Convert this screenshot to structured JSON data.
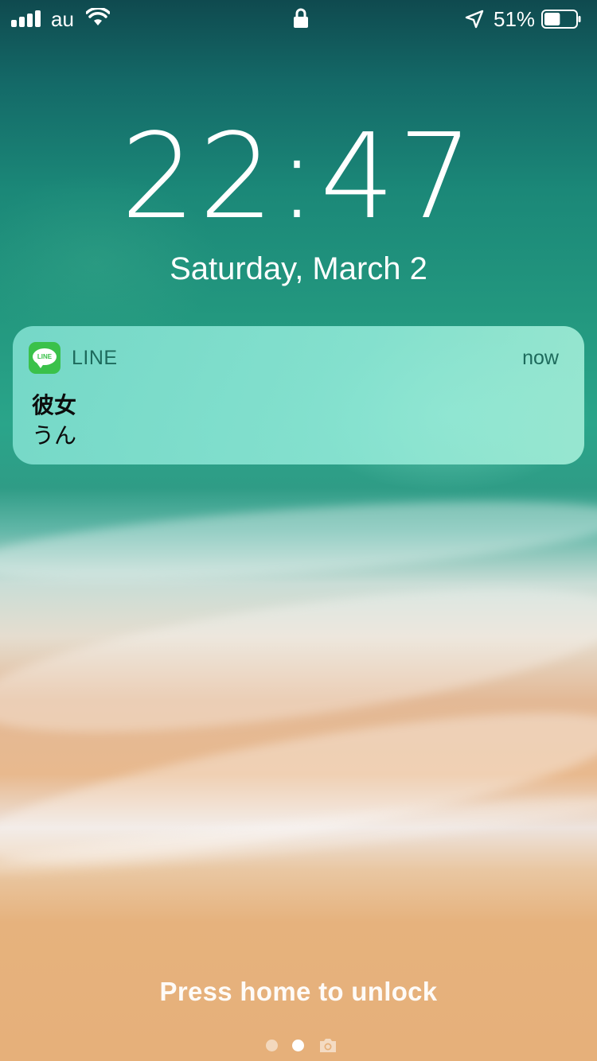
{
  "status_bar": {
    "carrier": "au",
    "battery_percent": "51%",
    "signal_bars": 4,
    "battery_level": 0.51,
    "icons": {
      "signal": "cellular-signal-icon",
      "wifi": "wifi-icon",
      "lock": "lock-icon",
      "location": "location-arrow-icon",
      "battery": "battery-icon"
    }
  },
  "lock_screen": {
    "time": "22:47",
    "date": "Saturday, March 2"
  },
  "notification": {
    "app_name": "LINE",
    "app_icon_text": "LINE",
    "app_icon": "line-app-icon",
    "app_color": "#3ac14a",
    "time": "now",
    "title": "彼女",
    "body": "うん"
  },
  "bottom": {
    "unlock_hint": "Press home to unlock",
    "pages": 2,
    "current_page": 2,
    "camera_icon": "camera-icon"
  }
}
